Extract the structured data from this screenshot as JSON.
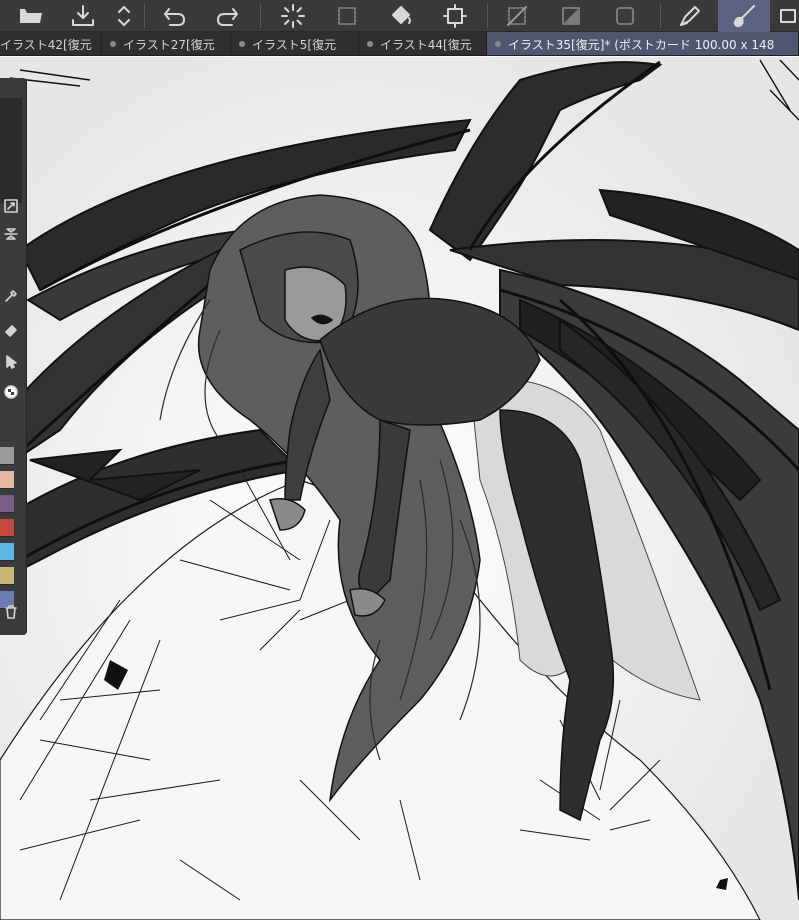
{
  "toolbar": {
    "buttons": [
      {
        "name": "open-folder-icon"
      },
      {
        "name": "save-icon"
      },
      {
        "name": "updown-icon"
      },
      {
        "name": "undo-icon"
      },
      {
        "name": "redo-icon"
      },
      {
        "name": "loading-spinner-icon"
      },
      {
        "name": "transform-selection-icon"
      },
      {
        "name": "fill-icon"
      },
      {
        "name": "canvas-size-icon"
      },
      {
        "name": "hide-selection-icon"
      },
      {
        "name": "tone-icon"
      },
      {
        "name": "layer-icon"
      },
      {
        "name": "pen-tool-icon"
      },
      {
        "name": "brush-tool-icon"
      },
      {
        "name": "more-tool-icon"
      }
    ]
  },
  "tabs": [
    {
      "label": "イラスト42[復元"
    },
    {
      "label": "イラスト27[復元"
    },
    {
      "label": "イラスト5[復元"
    },
    {
      "label": "イラスト44[復元"
    },
    {
      "label": "イラスト35[復元]* (ポストカード 100.00 x 148",
      "active": true
    }
  ],
  "left_panel": {
    "tools": [
      {
        "name": "fit-canvas-icon"
      },
      {
        "name": "flip-vertical-icon"
      },
      {
        "name": "eyedropper-icon"
      },
      {
        "name": "eraser-icon"
      },
      {
        "name": "selection-tool-icon"
      },
      {
        "name": "transparent-color-icon"
      },
      {
        "name": "trash-icon"
      }
    ],
    "swatches": [
      "#9a9a9a",
      "#e3b7a0",
      "#7a5d86",
      "#c4493a",
      "#5cb6e8",
      "#c9b778",
      "#6c7bb0"
    ]
  },
  "colors": {
    "toolbar_bg": "#3a3a3c",
    "tab_active_bg": "#4f5670",
    "accent_active_tool": "#5b6380"
  }
}
